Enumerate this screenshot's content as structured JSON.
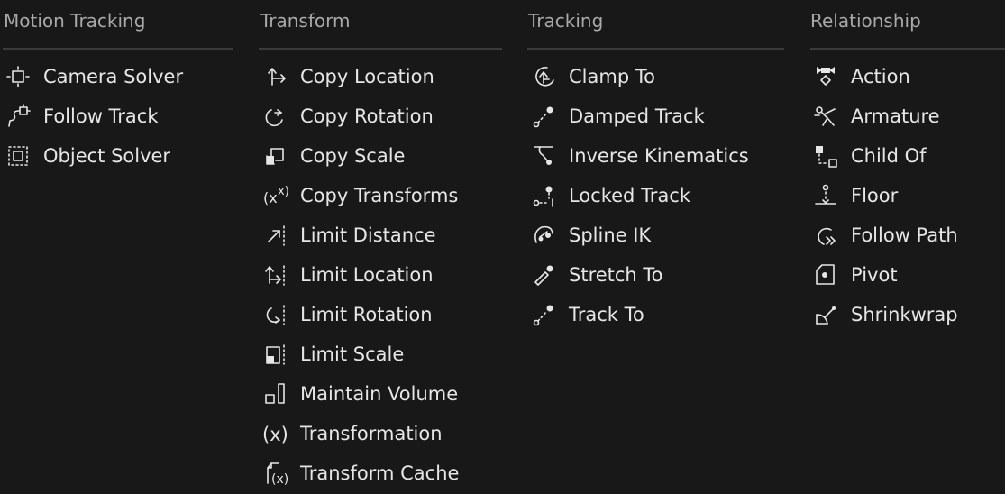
{
  "columns": [
    {
      "header": "Motion Tracking",
      "items": [
        {
          "label": "Camera Solver",
          "icon": "camera-solver-icon"
        },
        {
          "label": "Follow Track",
          "icon": "follow-track-icon"
        },
        {
          "label": "Object Solver",
          "icon": "object-solver-icon"
        }
      ]
    },
    {
      "header": "Transform",
      "items": [
        {
          "label": "Copy Location",
          "icon": "copy-location-icon"
        },
        {
          "label": "Copy Rotation",
          "icon": "copy-rotation-icon"
        },
        {
          "label": "Copy Scale",
          "icon": "copy-scale-icon"
        },
        {
          "label": "Copy Transforms",
          "icon": "copy-transforms-icon"
        },
        {
          "label": "Limit Distance",
          "icon": "limit-distance-icon"
        },
        {
          "label": "Limit Location",
          "icon": "limit-location-icon"
        },
        {
          "label": "Limit Rotation",
          "icon": "limit-rotation-icon"
        },
        {
          "label": "Limit Scale",
          "icon": "limit-scale-icon"
        },
        {
          "label": "Maintain Volume",
          "icon": "maintain-volume-icon"
        },
        {
          "label": "Transformation",
          "icon": "transformation-icon"
        },
        {
          "label": "Transform Cache",
          "icon": "transform-cache-icon"
        }
      ]
    },
    {
      "header": "Tracking",
      "items": [
        {
          "label": "Clamp To",
          "icon": "clamp-to-icon"
        },
        {
          "label": "Damped Track",
          "icon": "damped-track-icon"
        },
        {
          "label": "Inverse Kinematics",
          "icon": "inverse-kinematics-icon"
        },
        {
          "label": "Locked Track",
          "icon": "locked-track-icon"
        },
        {
          "label": "Spline IK",
          "icon": "spline-ik-icon"
        },
        {
          "label": "Stretch To",
          "icon": "stretch-to-icon"
        },
        {
          "label": "Track To",
          "icon": "track-to-icon"
        }
      ]
    },
    {
      "header": "Relationship",
      "items": [
        {
          "label": "Action",
          "icon": "action-icon"
        },
        {
          "label": "Armature",
          "icon": "armature-icon"
        },
        {
          "label": "Child Of",
          "icon": "child-of-icon"
        },
        {
          "label": "Floor",
          "icon": "floor-icon"
        },
        {
          "label": "Follow Path",
          "icon": "follow-path-icon"
        },
        {
          "label": "Pivot",
          "icon": "pivot-icon"
        },
        {
          "label": "Shrinkwrap",
          "icon": "shrinkwrap-icon"
        }
      ]
    }
  ]
}
